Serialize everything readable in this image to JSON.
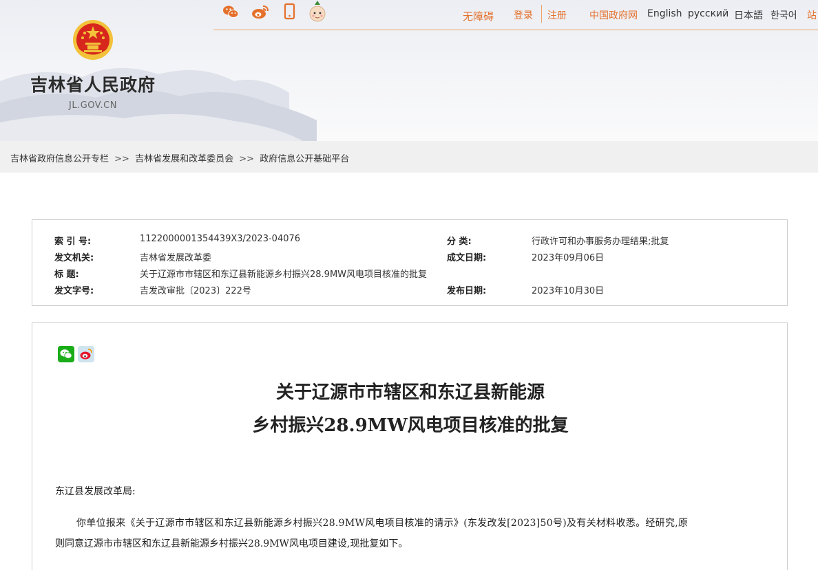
{
  "header": {
    "site_name": "吉林省人民政府",
    "site_domain": "JL.GOV.CN",
    "social_icons": [
      "weixin-icon",
      "weibo-icon",
      "mobile-icon",
      "mascot-icon"
    ],
    "accessibility_label": "无障碍",
    "login_label": "登录",
    "register_label": "注册",
    "central_gov_label": "中国政府网",
    "lang_english": "English",
    "lang_russian": "русский",
    "lang_japanese": "日本語",
    "lang_korean": "한국어",
    "site_map_partial": "站"
  },
  "breadcrumb": {
    "items": [
      "吉林省政府信息公开专栏",
      "吉林省发展和改革委员会",
      "政府信息公开基础平台"
    ],
    "separator": ">>"
  },
  "meta": {
    "index_label": "索 引 号:",
    "index_value": "1122000001354439X3/2023-04076",
    "category_label": "分    类:",
    "category_value": "行政许可和办事服务办理结果;批复",
    "issuer_label": "发文机关:",
    "issuer_value": "吉林省发展改革委",
    "created_label": "成文日期:",
    "created_value": "2023年09月06日",
    "title_label": "标    题:",
    "title_value": "关于辽源市市辖区和东辽县新能源乡村振兴28.9MW风电项目核准的批复",
    "doc_no_label": "发文字号:",
    "doc_no_value": "吉发改审批〔2023〕222号",
    "published_label": "发布日期:",
    "published_value": "2023年10月30日"
  },
  "article": {
    "share_icons": [
      "wechat-share-icon",
      "weibo-share-icon"
    ],
    "title_line1": "关于辽源市市辖区和东辽县新能源",
    "title_line2": "乡村振兴28.9MW风电项目核准的批复",
    "salutation": "东辽县发展改革局:",
    "para1_line1": "你单位报来《关于辽源市市辖区和东辽县新能源乡村振兴28.9MW风电项目核准的请示》(东发改发[2023]50号)及有关材料收悉。经研究,原",
    "para1_line2": "则同意辽源市市辖区和东辽县新能源乡村振兴28.9MW风电项目建设,现批复如下。"
  },
  "colors": {
    "accent_orange": "#e4702b",
    "emblem_red": "#d7271c",
    "emblem_gold": "#f2c23a",
    "wechat_green": "#1aad19"
  }
}
